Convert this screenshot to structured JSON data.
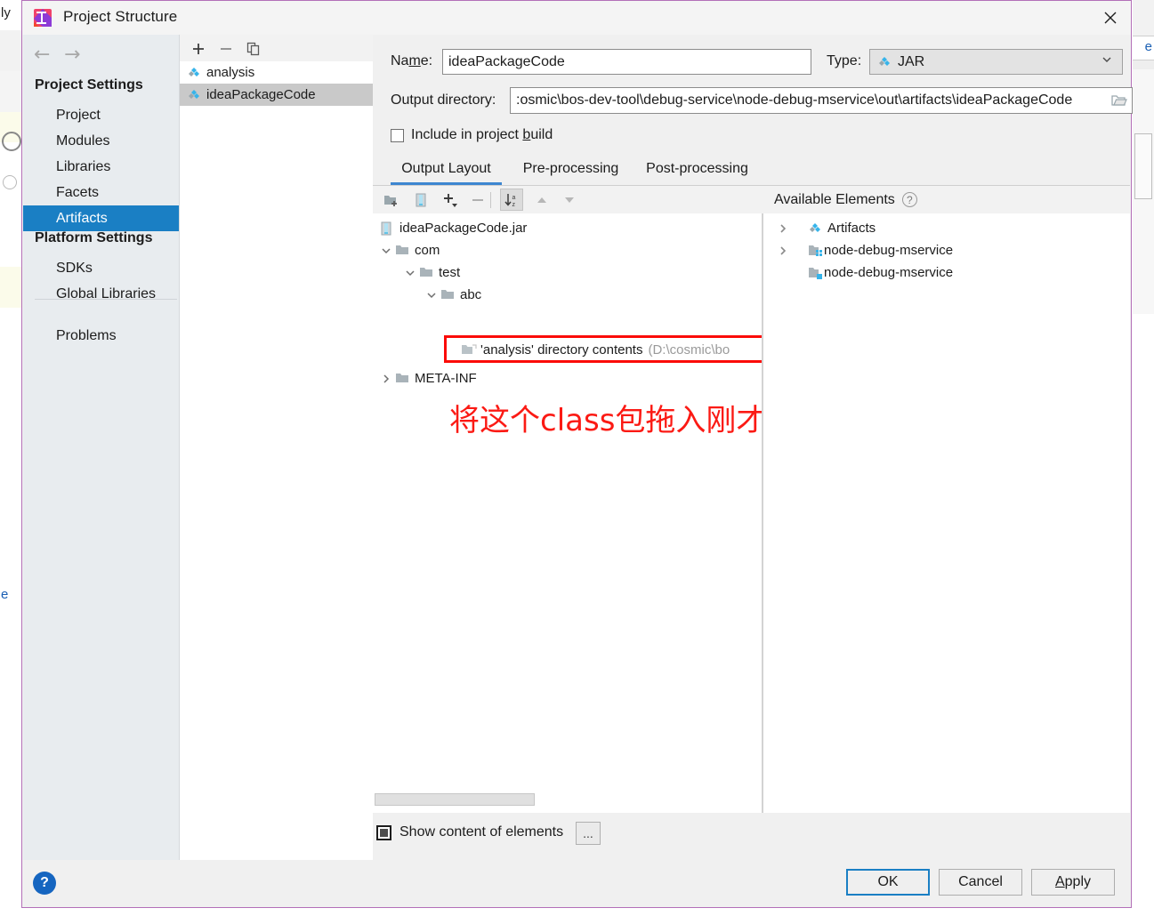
{
  "window": {
    "title": "Project Structure",
    "app_icon": "intellij-idea-icon",
    "close_icon": "close-icon"
  },
  "settings_pane": {
    "back_icon": "arrow-left-icon",
    "forward_icon": "arrow-right-icon",
    "groups": [
      {
        "label": "Project Settings",
        "items": [
          {
            "label": "Project",
            "selected": false
          },
          {
            "label": "Modules",
            "selected": false
          },
          {
            "label": "Libraries",
            "selected": false
          },
          {
            "label": "Facets",
            "selected": false
          },
          {
            "label": "Artifacts",
            "selected": true
          }
        ]
      },
      {
        "label": "Platform Settings",
        "items": [
          {
            "label": "SDKs",
            "selected": false
          },
          {
            "label": "Global Libraries",
            "selected": false
          }
        ]
      }
    ],
    "extra_items": [
      {
        "label": "Problems",
        "selected": false
      }
    ]
  },
  "artifacts_pane": {
    "toolbar": [
      {
        "name": "add-artifact-button",
        "icon": "plus-icon",
        "label": "+"
      },
      {
        "name": "remove-artifact-button",
        "icon": "minus-icon",
        "label": "−"
      },
      {
        "name": "copy-artifact-button",
        "icon": "copy-icon",
        "label": ""
      }
    ],
    "items": [
      {
        "label": "analysis",
        "icon": "artifact-icon",
        "selected": false
      },
      {
        "label": "ideaPackageCode",
        "icon": "artifact-icon",
        "selected": true
      }
    ]
  },
  "form": {
    "name_label": "Name:",
    "name_label_pre": "Na",
    "name_label_mnemonic": "m",
    "name_label_post": "e:",
    "name_value": "ideaPackageCode",
    "type_label": "Type:",
    "type_value": "JAR",
    "type_icon": "artifact-icon",
    "type_caret": "chevron-down-icon",
    "output_dir_label": "Output directory:",
    "output_dir_value": ":osmic\\bos-dev-tool\\debug-service\\node-debug-mservice\\out\\artifacts\\ideaPackageCode",
    "browse_icon": "folder-browse-icon",
    "include_label_pre": "Include in project ",
    "include_label_mnemonic": "b",
    "include_label_post": "uild",
    "include_checked": false
  },
  "tabs": [
    {
      "label": "Output Layout",
      "active": true
    },
    {
      "label": "Pre-processing",
      "active": false
    },
    {
      "label": "Post-processing",
      "active": false
    }
  ],
  "layout_toolbar": [
    {
      "name": "add-directory-button",
      "icon": "folder-add-icon",
      "toggled": false
    },
    {
      "name": "add-archive-button",
      "icon": "archive-icon",
      "toggled": false
    },
    {
      "name": "add-element-button",
      "icon": "plus-dropdown-icon",
      "toggled": false
    },
    {
      "name": "remove-element-button",
      "icon": "minus-icon",
      "toggled": false
    },
    {
      "name": "sort-alphabetically-button",
      "icon": "sort-az-icon",
      "toggled": true
    },
    {
      "name": "move-up-button",
      "icon": "arrow-up-icon",
      "toggled": false
    },
    {
      "name": "move-down-button",
      "icon": "arrow-down-icon",
      "toggled": false
    }
  ],
  "output_tree": [
    {
      "label": "ideaPackageCode.jar",
      "detail": "",
      "icon": "archive-icon",
      "indent": 0,
      "arrow": "none"
    },
    {
      "label": "com",
      "detail": "",
      "icon": "folder-icon",
      "indent": 1,
      "arrow": "expanded"
    },
    {
      "label": "test",
      "detail": "",
      "icon": "folder-icon",
      "indent": 2,
      "arrow": "expanded"
    },
    {
      "label": "abc",
      "detail": "",
      "icon": "folder-icon",
      "indent": 3,
      "arrow": "expanded"
    },
    {
      "label": "'analysis' directory contents",
      "detail": "(D:\\cosmic\\bo",
      "icon": "directory-contents-icon",
      "indent": 4,
      "arrow": "none"
    },
    {
      "label": "META-INF",
      "detail": "",
      "icon": "folder-icon",
      "indent": 1,
      "arrow": "collapsed"
    }
  ],
  "available_elements": {
    "header": "Available Elements",
    "help_icon": "question-mark-icon",
    "rows": [
      {
        "label": "Artifacts",
        "icon": "artifact-icon",
        "arrow": "collapsed"
      },
      {
        "label": "node-debug-mservice",
        "icon": "module-icon",
        "arrow": "collapsed"
      },
      {
        "label": "node-debug-mservice",
        "icon": "module-output-icon",
        "arrow": "none"
      }
    ]
  },
  "annotation": {
    "text": "将这个class包拖入刚才创建的目录结构中",
    "color": "#fb1a14",
    "highlight_box_color": "#fb0b08"
  },
  "bottom_bar": {
    "show_content_label": "Show content of elements",
    "show_content_checked": true,
    "ellipsis_button_label": "...",
    "help_button_label": "?"
  },
  "footer_buttons": [
    {
      "label": "OK",
      "name": "ok-button",
      "default": true
    },
    {
      "label": "Cancel",
      "name": "cancel-button",
      "default": false
    },
    {
      "label": "Apply",
      "name": "apply-button",
      "default": false,
      "mnemonic": "A"
    }
  ],
  "colors": {
    "selection_blue": "#1a7fc4",
    "tab_underline": "#3d86d0",
    "dialog_border": "#b36fb8",
    "artifact_blue": "#37b4ea",
    "annotation_red": "#fb1a14"
  },
  "background_app": {
    "left_text_1": "ly",
    "left_text_2": "e"
  }
}
